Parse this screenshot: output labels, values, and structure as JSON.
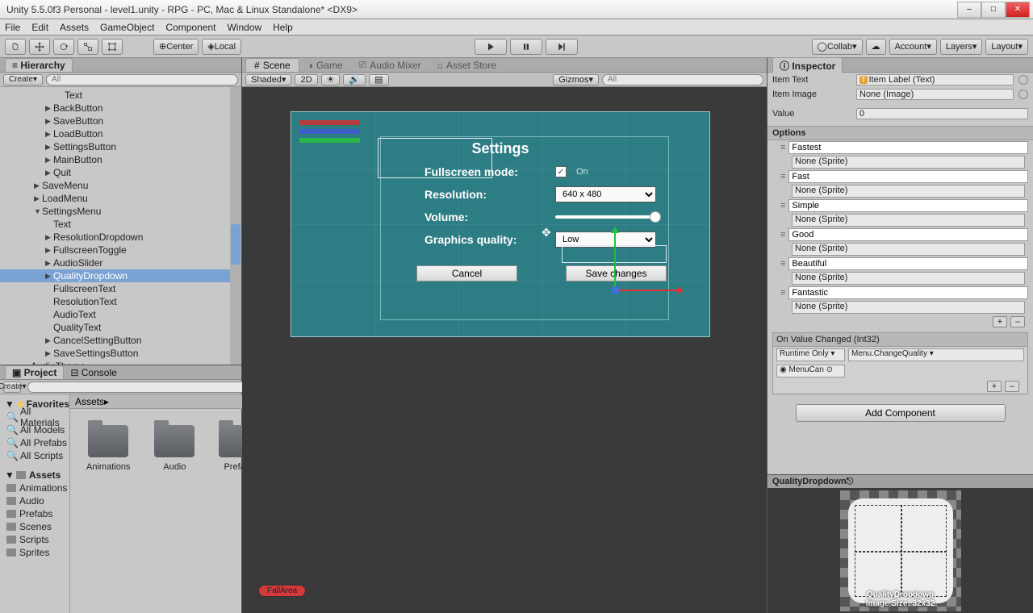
{
  "titlebar": {
    "title": "Unity 5.5.0f3 Personal - level1.unity - RPG - PC, Mac & Linux Standalone* <DX9>"
  },
  "menubar": [
    "File",
    "Edit",
    "Assets",
    "GameObject",
    "Component",
    "Window",
    "Help"
  ],
  "toolbar": {
    "center_label": "Center",
    "local_label": "Local",
    "collab_label": "Collab",
    "account_label": "Account",
    "layers_label": "Layers",
    "layout_label": "Layout"
  },
  "hierarchy": {
    "title": "Hierarchy",
    "create_label": "Create",
    "search_placeholder": "All",
    "items": [
      {
        "indent": 3,
        "arrow": "",
        "label": "Text"
      },
      {
        "indent": 2,
        "arrow": "▶",
        "label": "BackButton"
      },
      {
        "indent": 2,
        "arrow": "▶",
        "label": "SaveButton"
      },
      {
        "indent": 2,
        "arrow": "▶",
        "label": "LoadButton"
      },
      {
        "indent": 2,
        "arrow": "▶",
        "label": "SettingsButton"
      },
      {
        "indent": 2,
        "arrow": "▶",
        "label": "MainButton"
      },
      {
        "indent": 2,
        "arrow": "▶",
        "label": "Quit"
      },
      {
        "indent": 1,
        "arrow": "▶",
        "label": "SaveMenu"
      },
      {
        "indent": 1,
        "arrow": "▶",
        "label": "LoadMenu"
      },
      {
        "indent": 1,
        "arrow": "▼",
        "label": "SettingsMenu"
      },
      {
        "indent": 2,
        "arrow": "",
        "label": "Text"
      },
      {
        "indent": 2,
        "arrow": "▶",
        "label": "ResolutionDropdown"
      },
      {
        "indent": 2,
        "arrow": "▶",
        "label": "FullscreenToggle"
      },
      {
        "indent": 2,
        "arrow": "▶",
        "label": "AudioSlider"
      },
      {
        "indent": 2,
        "arrow": "▶",
        "label": "QualityDropdown",
        "selected": true
      },
      {
        "indent": 2,
        "arrow": "",
        "label": "FullscreenText"
      },
      {
        "indent": 2,
        "arrow": "",
        "label": "ResolutionText"
      },
      {
        "indent": 2,
        "arrow": "",
        "label": "AudioText"
      },
      {
        "indent": 2,
        "arrow": "",
        "label": "QualityText"
      },
      {
        "indent": 2,
        "arrow": "▶",
        "label": "CancelSettingButton"
      },
      {
        "indent": 2,
        "arrow": "▶",
        "label": "SaveSettingsButton"
      },
      {
        "indent": 0,
        "arrow": "",
        "label": "AudioTheme"
      }
    ]
  },
  "scene_tabs": {
    "scene": "Scene",
    "game": "Game",
    "audio": "Audio Mixer",
    "store": "Asset Store"
  },
  "scene_toolbar": {
    "shaded": "Shaded",
    "mode2d": "2D",
    "gizmos": "Gizmos",
    "search_placeholder": "All"
  },
  "settings_ui": {
    "title": "Settings",
    "fullscreen_label": "Fullscreen mode:",
    "fullscreen_on": "On",
    "resolution_label": "Resolution:",
    "resolution_value": "640 x 480",
    "volume_label": "Volume:",
    "quality_label": "Graphics quality:",
    "quality_value": "Low",
    "cancel": "Cancel",
    "save": "Save changes",
    "fall": "FallArea"
  },
  "project": {
    "tab_project": "Project",
    "tab_console": "Console",
    "create_label": "Create",
    "favorites": "Favorites",
    "fav_items": [
      "All Materials",
      "All Models",
      "All Prefabs",
      "All Scripts"
    ],
    "assets_label": "Assets",
    "asset_folders": [
      "Animations",
      "Audio",
      "Prefabs",
      "Scenes",
      "Scripts",
      "Sprites"
    ],
    "breadcrumb": "Assets"
  },
  "inspector": {
    "title": "Inspector",
    "item_text_label": "Item Text",
    "item_text_value": "Item Label (Text)",
    "item_image_label": "Item Image",
    "item_image_value": "None (Image)",
    "value_label": "Value",
    "value_value": "0",
    "options_label": "Options",
    "options": [
      {
        "name": "Fastest",
        "sprite": "None (Sprite)"
      },
      {
        "name": "Fast",
        "sprite": "None (Sprite)"
      },
      {
        "name": "Simple",
        "sprite": "None (Sprite)"
      },
      {
        "name": "Good",
        "sprite": "None (Sprite)"
      },
      {
        "name": "Beautiful",
        "sprite": "None (Sprite)"
      },
      {
        "name": "Fantastic",
        "sprite": "None (Sprite)"
      }
    ],
    "event_header": "On Value Changed (Int32)",
    "event_runtime": "Runtime Only",
    "event_method": "Menu.ChangeQuality",
    "event_obj": "MenuCan",
    "add_component": "Add Component",
    "preview_title": "QualityDropdown",
    "preview_caption": "QualityDropdown",
    "preview_size": "Image Size: 32x32"
  }
}
